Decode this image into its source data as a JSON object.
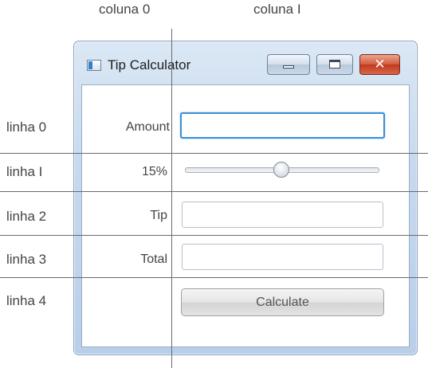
{
  "annotations": {
    "columns": [
      "coluna 0",
      "coluna I"
    ],
    "rows": [
      "linha 0",
      "linha I",
      "linha 2",
      "linha 3",
      "linha 4"
    ]
  },
  "window": {
    "title": "Tip Calculator",
    "title_icon": "app-window-icon",
    "controls": {
      "minimize_icon": "minimize-icon",
      "maximize_icon": "maximize-icon",
      "close_icon": "close-icon",
      "close_glyph": "✕",
      "close_color": "#d45a3c"
    }
  },
  "form": {
    "amount": {
      "label": "Amount",
      "value": ""
    },
    "percentage": {
      "label": "15%",
      "slider_fraction": 0.5
    },
    "tip": {
      "label": "Tip",
      "value": ""
    },
    "total": {
      "label": "Total",
      "value": ""
    },
    "calculate": {
      "label": "Calculate"
    }
  },
  "colors": {
    "focus_border": "#3a8fd6",
    "window_frame": "#c6d9ee"
  }
}
